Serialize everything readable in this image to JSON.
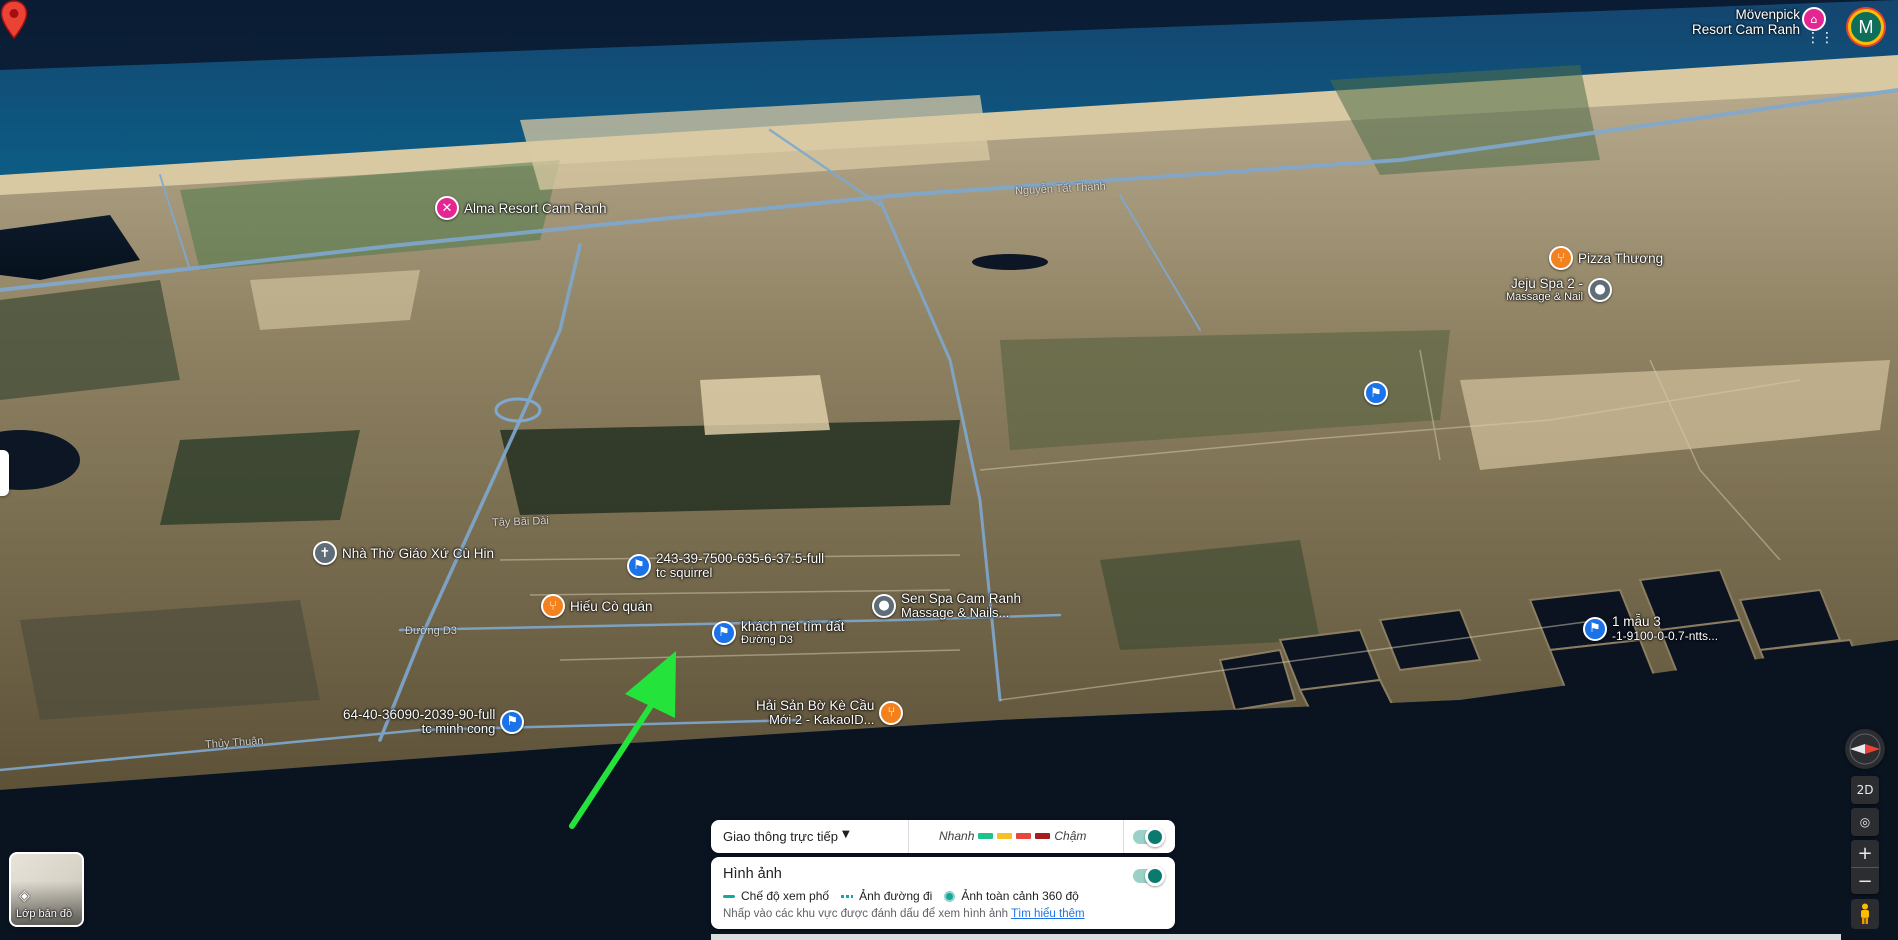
{
  "map": {
    "pois": [
      {
        "id": "alma",
        "label": "Alma Resort Cam Ranh",
        "sub": "",
        "icon": "cocktail-icon",
        "color": "#e52592"
      },
      {
        "id": "pizza",
        "label": "Pizza Thương",
        "sub": "",
        "icon": "fork-knife-icon",
        "color": "#f3811e"
      },
      {
        "id": "jeju",
        "label": "Jeju Spa 2 -",
        "sub": "Massage & Nail",
        "icon": "spa-icon",
        "color": "#5f6d78"
      },
      {
        "id": "church",
        "label": "Nhà Thờ Giáo Xứ Cù Hin",
        "sub": "",
        "icon": "cross-icon",
        "color": "#5f6d78"
      },
      {
        "id": "squirrel",
        "label": "243-39-7500-635-6-37.5-full",
        "sub": "tc squirrel",
        "icon": "flag-icon",
        "color": "#1a73e8"
      },
      {
        "id": "hieu",
        "label": "Hiếu Cò quán",
        "sub": "",
        "icon": "fork-knife-icon",
        "color": "#f3811e"
      },
      {
        "id": "khach",
        "label": "khách nét tìm đất",
        "sub": "Đường D3",
        "icon": "flag-icon",
        "color": "#1a73e8"
      },
      {
        "id": "senspa",
        "label": "Sen Spa Cam Ranh",
        "sub": "Massage & Nails...",
        "icon": "spa-icon",
        "color": "#5f6d78"
      },
      {
        "id": "mau3",
        "label": "1 mẫu 3",
        "sub": "-1-9100-0-0.7-ntts...",
        "icon": "flag-icon",
        "color": "#1a73e8"
      },
      {
        "id": "haisan",
        "label": "Hải Sản Bờ Kè Cầu",
        "sub": "Mới 2 - KakaoID...",
        "icon": "fork-knife-icon",
        "color": "#f3811e"
      },
      {
        "id": "minhcong",
        "label": "64-40-36090-2039-90-full",
        "sub": "tc minh cong",
        "icon": "flag-icon",
        "color": "#1a73e8"
      }
    ],
    "roads": {
      "nguyen_tat_thanh": "Nguyễn Tất Thành",
      "duong_d3": "Đường D3",
      "thuy_thuan": "Thủy Thuận",
      "tay_bai_dai": "Tây Bãi Dài"
    }
  },
  "top_right": {
    "resort_line1": "Mövenpick",
    "resort_line2": "Resort Cam Ranh",
    "avatar_letter": "M"
  },
  "layers": {
    "label": "Lớp bản đồ"
  },
  "controls": {
    "view_mode": "2D"
  },
  "traffic": {
    "label": "Giao thông trực tiếp",
    "fast": "Nhanh",
    "slow": "Chậm",
    "colors": [
      "#1ec28b",
      "#f6c026",
      "#e8453c",
      "#a51d1d"
    ]
  },
  "imagery": {
    "title": "Hình ảnh",
    "street_view": "Chế độ xem phố",
    "route_photos": "Ảnh đường đi",
    "panorama": "Ảnh toàn cảnh 360 độ",
    "note": "Nhấp vào các khu vực được đánh dấu để xem hình ảnh",
    "learn_more": "Tìm hiểu thêm"
  }
}
